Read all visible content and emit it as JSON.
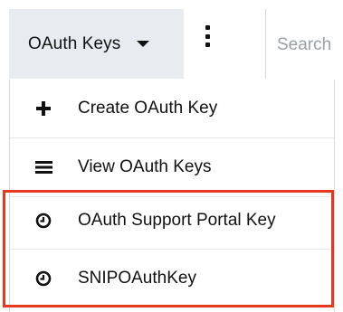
{
  "header": {
    "module_label": "OAuth Keys",
    "search_placeholder": "Search"
  },
  "menu": {
    "items": [
      {
        "label": "Create OAuth Key",
        "icon": "plus-icon"
      },
      {
        "label": "View OAuth Keys",
        "icon": "list-icon"
      },
      {
        "label": "OAuth Support Portal Key",
        "icon": "clock-icon"
      },
      {
        "label": "SNIPOAuthKey",
        "icon": "clock-icon"
      }
    ]
  },
  "colors": {
    "tab_background": "#e8ecf1",
    "highlight_border": "#e8391f",
    "divider": "#d5d9de"
  }
}
